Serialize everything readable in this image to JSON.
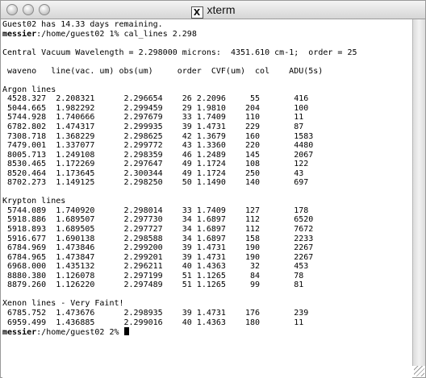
{
  "window": {
    "title": "xterm",
    "x_badge": "X"
  },
  "intro": [
    "Guest02 has 14.33 days remaining.",
    "messier:/home/guest02 1% cal_lines 2.298",
    "",
    "Central Vacuum Wavelength = 2.298000 microns:  4351.610 cm-1;  order = 25",
    ""
  ],
  "headers": [
    "waveno",
    "line(vac. um)",
    "obs(um)",
    "order",
    "CVF(um)",
    "col",
    "ADU(5s)"
  ],
  "sections": [
    {
      "title": "Argon lines",
      "rows": [
        [
          "4528.327",
          "2.208321",
          "2.296654",
          "26",
          "2.2096",
          "55",
          "416"
        ],
        [
          "5044.665",
          "1.982292",
          "2.299459",
          "29",
          "1.9810",
          "204",
          "100"
        ],
        [
          "5744.928",
          "1.740666",
          "2.297679",
          "33",
          "1.7409",
          "110",
          "11"
        ],
        [
          "6782.802",
          "1.474317",
          "2.299935",
          "39",
          "1.4731",
          "229",
          "87"
        ],
        [
          "7308.718",
          "1.368229",
          "2.298625",
          "42",
          "1.3679",
          "160",
          "1583"
        ],
        [
          "7479.001",
          "1.337077",
          "2.299772",
          "43",
          "1.3360",
          "220",
          "4480"
        ],
        [
          "8005.713",
          "1.249108",
          "2.298359",
          "46",
          "1.2489",
          "145",
          "2067"
        ],
        [
          "8530.465",
          "1.172269",
          "2.297647",
          "49",
          "1.1724",
          "108",
          "122"
        ],
        [
          "8520.464",
          "1.173645",
          "2.300344",
          "49",
          "1.1724",
          "250",
          "43"
        ],
        [
          "8702.273",
          "1.149125",
          "2.298250",
          "50",
          "1.1490",
          "140",
          "697"
        ]
      ]
    },
    {
      "title": "Krypton lines",
      "rows": [
        [
          "5744.089",
          "1.740920",
          "2.298014",
          "33",
          "1.7409",
          "127",
          "178"
        ],
        [
          "5918.886",
          "1.689507",
          "2.297730",
          "34",
          "1.6897",
          "112",
          "6520"
        ],
        [
          "5918.893",
          "1.689505",
          "2.297727",
          "34",
          "1.6897",
          "112",
          "7672"
        ],
        [
          "5916.677",
          "1.690138",
          "2.298588",
          "34",
          "1.6897",
          "158",
          "2233"
        ],
        [
          "6784.969",
          "1.473846",
          "2.299200",
          "39",
          "1.4731",
          "190",
          "2267"
        ],
        [
          "6784.965",
          "1.473847",
          "2.299201",
          "39",
          "1.4731",
          "190",
          "2267"
        ],
        [
          "6968.000",
          "1.435132",
          "2.296211",
          "40",
          "1.4363",
          "32",
          "453"
        ],
        [
          "8880.380",
          "1.126078",
          "2.297199",
          "51",
          "1.1265",
          "84",
          "78"
        ],
        [
          "8879.260",
          "1.126220",
          "2.297489",
          "51",
          "1.1265",
          "99",
          "81"
        ]
      ]
    },
    {
      "title": "Xenon lines - Very Faint!",
      "rows": [
        [
          "6785.752",
          "1.473676",
          "2.298935",
          "39",
          "1.4731",
          "176",
          "239"
        ],
        [
          "6959.499",
          "1.436885",
          "2.299016",
          "40",
          "1.4363",
          "180",
          "11"
        ]
      ]
    }
  ],
  "prompt": "messier:/home/guest02 2% "
}
